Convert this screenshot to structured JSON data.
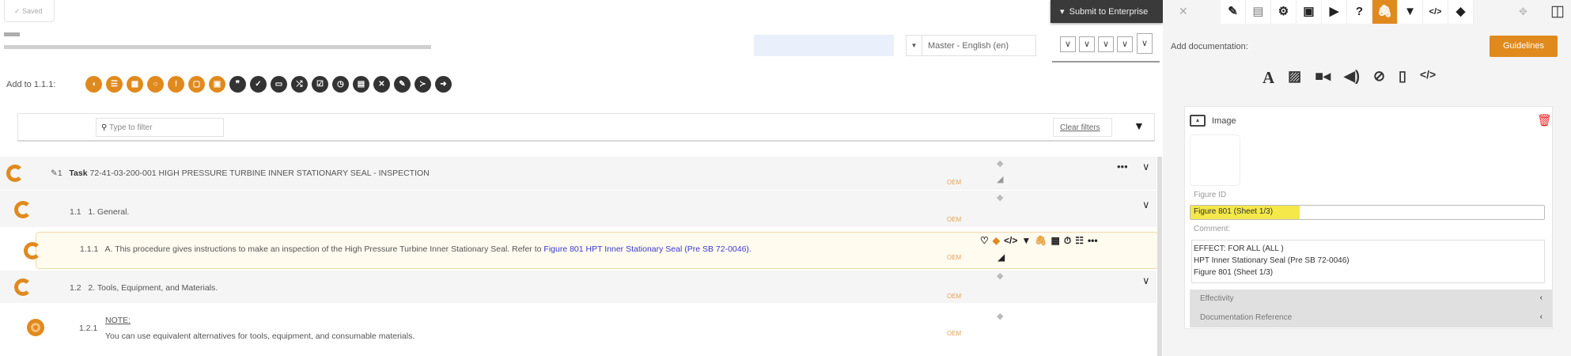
{
  "header": {
    "saved_label": "✓ Saved",
    "submit_label": "Submit to Enterprise",
    "language": "Master - English (en)"
  },
  "add_bar": {
    "label": "Add to 1.1.1:",
    "icons": [
      {
        "name": "step-icon",
        "color": "#e08a1e",
        "glyph": "◖"
      },
      {
        "name": "list-icon",
        "color": "#e08a1e",
        "glyph": "☰"
      },
      {
        "name": "table-icon",
        "color": "#e08a1e",
        "glyph": "▦"
      },
      {
        "name": "circle-icon",
        "color": "#e08a1e",
        "glyph": "○"
      },
      {
        "name": "warning-icon",
        "color": "#e08a1e",
        "glyph": "!"
      },
      {
        "name": "caution-icon",
        "color": "#e08a1e",
        "glyph": "▢"
      },
      {
        "name": "note-icon",
        "color": "#e08a1e",
        "glyph": "▣"
      },
      {
        "name": "quote-icon",
        "color": "#333",
        "glyph": "❞"
      },
      {
        "name": "check-cross-icon",
        "color": "#333",
        "glyph": "✓"
      },
      {
        "name": "input-icon",
        "color": "#333",
        "glyph": "▭"
      },
      {
        "name": "shuffle-icon",
        "color": "#333",
        "glyph": "⤮"
      },
      {
        "name": "checkbox-icon",
        "color": "#333",
        "glyph": "☑"
      },
      {
        "name": "clock-icon",
        "color": "#333",
        "glyph": "◷"
      },
      {
        "name": "calculator-icon",
        "color": "#333",
        "glyph": "▤"
      },
      {
        "name": "tools-icon",
        "color": "#333",
        "glyph": "✕"
      },
      {
        "name": "edit-icon",
        "color": "#333",
        "glyph": "✎"
      },
      {
        "name": "branch-icon",
        "color": "#333",
        "glyph": "≻"
      },
      {
        "name": "arrow-right-icon",
        "color": "#333",
        "glyph": "➜"
      }
    ]
  },
  "filter": {
    "placeholder": "Type to filter",
    "clear_label": "Clear filters"
  },
  "rows": [
    {
      "num": "1",
      "bold": "Task",
      "text": "72-41-03-200-001 HIGH PRESSURE TURBINE INNER STATIONARY SEAL - INSPECTION",
      "oem": "OEM"
    },
    {
      "num": "1.1",
      "text": "1. General.",
      "oem": "OEM"
    },
    {
      "num": "1.1.1",
      "text": "A. This procedure gives instructions to make an inspection of the High Pressure Turbine Inner Stationary Seal. Refer to",
      "link": "Figure 801 HPT Inner Stationary Seal (Pre SB 72-0046).",
      "oem": "OEM"
    },
    {
      "num": "1.2",
      "text": "2. Tools, Equipment, and Materials.",
      "oem": "OEM"
    },
    {
      "num": "1.2.1",
      "title": "NOTE:",
      "text": "You can use equivalent alternatives for tools, equipment, and consumable materials.",
      "oem": "OEM"
    }
  ],
  "right": {
    "add_doc_label": "Add documentation:",
    "guidelines_label": "Guidelines",
    "card": {
      "title": "Image",
      "figure_id_label": "Figure ID",
      "figure_id": "Figure 801 (Sheet 1/3)",
      "comment_label": "Comment:",
      "comment": "EFFECT: FOR ALL (ALL )\nHPT Inner Stationary Seal (Pre SB 72-0046)\nFigure 801 (Sheet 1/3)",
      "sections": [
        "Effectivity",
        "Documentation Reference"
      ]
    }
  },
  "colors": {
    "accent": "#e08a1e",
    "link": "#3a3ad0",
    "highlight": "#f5e84a"
  }
}
